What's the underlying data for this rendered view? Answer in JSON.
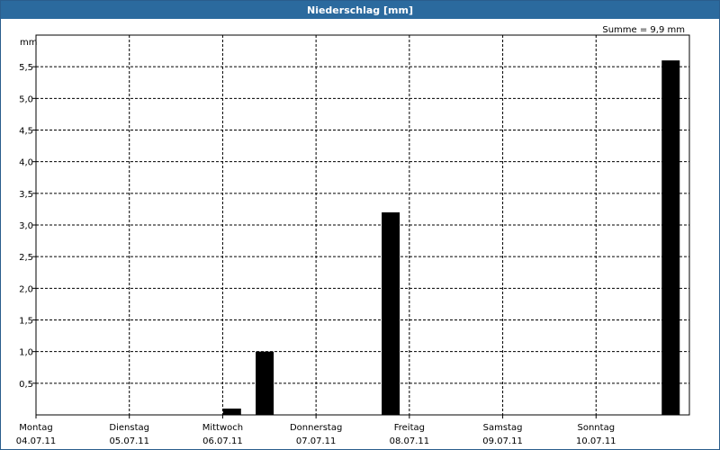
{
  "window": {
    "title": "Niederschlag [mm]"
  },
  "summary": "Summe = 9,9 mm",
  "chart_data": {
    "type": "bar",
    "title": "Niederschlag [mm]",
    "ylabel": "mm",
    "ylim": [
      0,
      6.0
    ],
    "yticks": [
      0.5,
      1.0,
      1.5,
      2.0,
      2.5,
      3.0,
      3.5,
      4.0,
      4.5,
      5.0,
      5.5
    ],
    "ytick_labels": [
      "0,5",
      "1,0",
      "1,5",
      "2,0",
      "2,5",
      "3,0",
      "3,5",
      "4,0",
      "4,5",
      "5,0",
      "5,5"
    ],
    "xlim": [
      0,
      7
    ],
    "days": [
      {
        "name": "Montag",
        "date": "04.07.11"
      },
      {
        "name": "Dienstag",
        "date": "05.07.11"
      },
      {
        "name": "Mittwoch",
        "date": "06.07.11"
      },
      {
        "name": "Donnerstag",
        "date": "07.07.11"
      },
      {
        "name": "Freitag",
        "date": "08.07.11"
      },
      {
        "name": "Samstag",
        "date": "09.07.11"
      },
      {
        "name": "Sonntag",
        "date": "10.07.11"
      }
    ],
    "bars": [
      {
        "x": 2.1,
        "value": 0.1
      },
      {
        "x": 2.45,
        "value": 1.0
      },
      {
        "x": 3.8,
        "value": 3.2
      },
      {
        "x": 6.8,
        "value": 5.6
      }
    ],
    "grid": true,
    "bar_color": "#000000"
  }
}
